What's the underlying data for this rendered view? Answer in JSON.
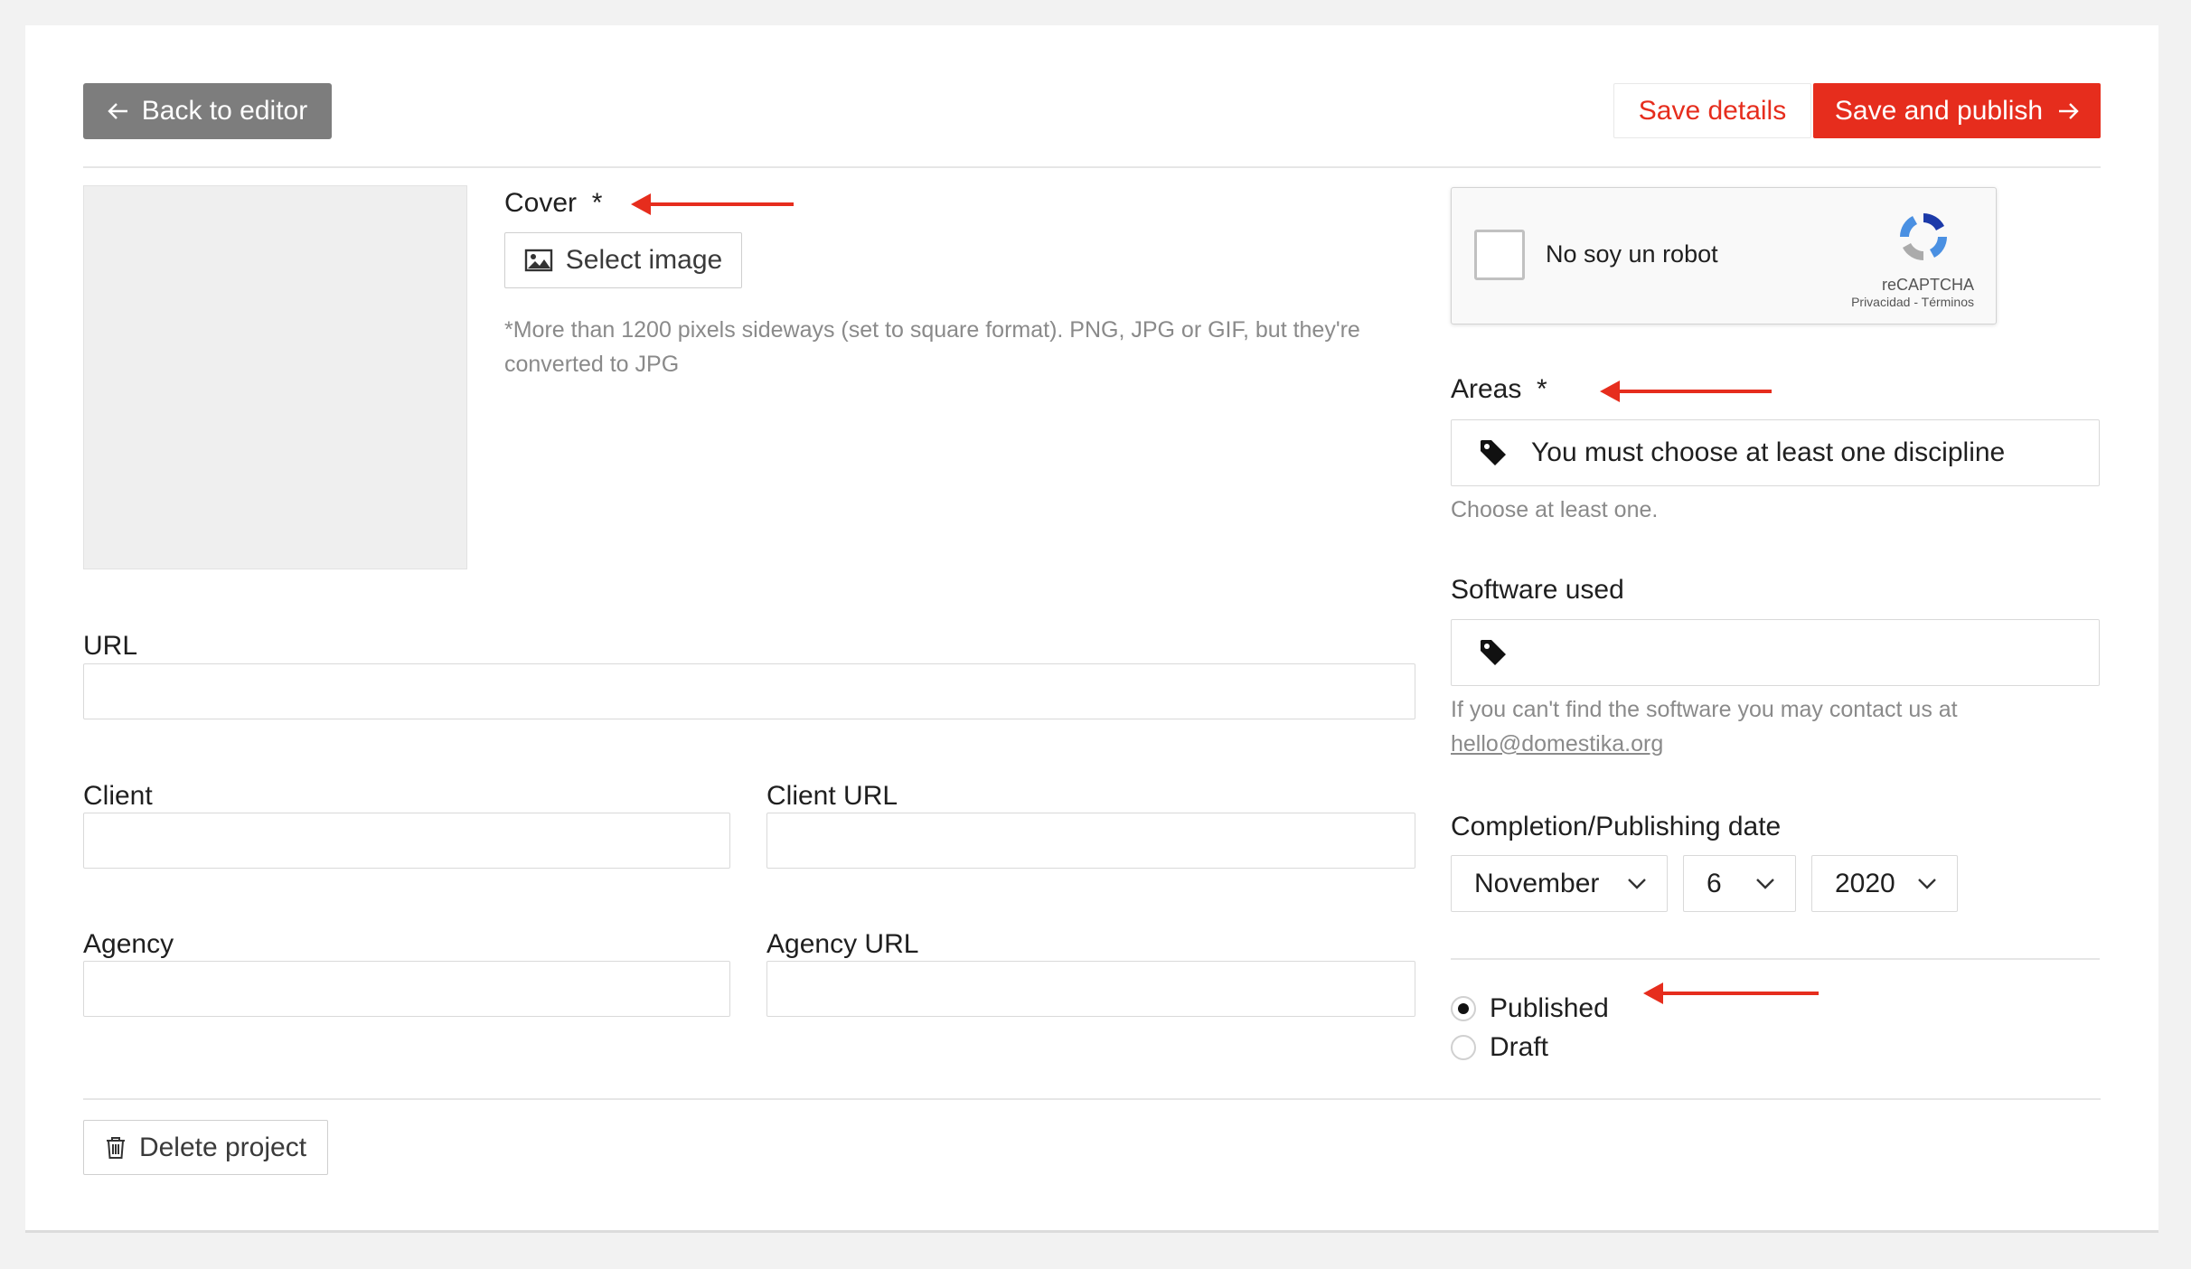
{
  "toolbar": {
    "back_label": "Back to editor",
    "save_details_label": "Save details",
    "save_publish_label": "Save and publish"
  },
  "cover": {
    "label": "Cover",
    "required_mark": "*",
    "select_label": "Select image",
    "hint": "*More than 1200 pixels sideways (set to square format). PNG, JPG or GIF, but they're converted to JPG"
  },
  "recaptcha": {
    "label": "No soy un robot",
    "brand": "reCAPTCHA",
    "privacy": "Privacidad",
    "separator": " - ",
    "terms": "Términos"
  },
  "areas": {
    "label": "Areas",
    "required_mark": "*",
    "placeholder": "You must choose at least one discipline",
    "hint": "Choose at least one."
  },
  "software": {
    "label": "Software used",
    "value": "",
    "hint": "If you can't find the software you may contact us at",
    "email": "hello@domestika.org"
  },
  "fields": {
    "url_label": "URL",
    "url_value": "",
    "client_label": "Client",
    "client_value": "",
    "client_url_label": "Client URL",
    "client_url_value": "",
    "agency_label": "Agency",
    "agency_value": "",
    "agency_url_label": "Agency URL",
    "agency_url_value": ""
  },
  "date": {
    "label": "Completion/Publishing date",
    "month": "November",
    "day": "6",
    "year": "2020"
  },
  "status": {
    "options": [
      "Published",
      "Draft"
    ],
    "selected": "Published"
  },
  "footer": {
    "delete_label": "Delete project"
  },
  "colors": {
    "accent": "#e62d1d",
    "back_button": "#7d7d7d",
    "hint_text": "#8a8a8a"
  }
}
